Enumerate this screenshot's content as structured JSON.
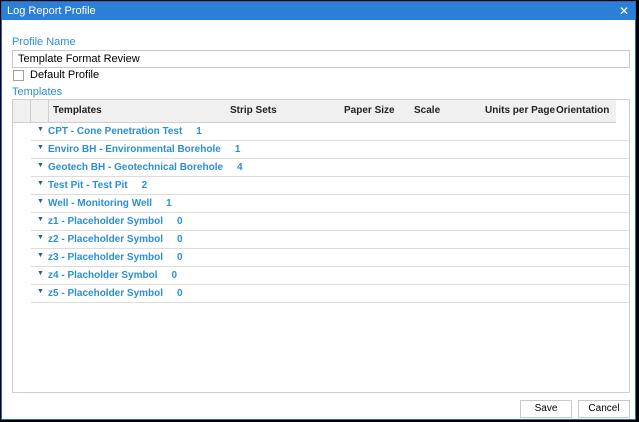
{
  "window": {
    "title": "Log Report Profile",
    "close_glyph": "✕"
  },
  "profile": {
    "label": "Profile Name",
    "value": "Template Format Review",
    "default_label": "Default Profile"
  },
  "templates": {
    "label": "Templates",
    "columns": [
      "Templates",
      "Strip Sets",
      "Paper Size",
      "Scale",
      "Units per Page",
      "Orientation"
    ],
    "rows": [
      {
        "name": "CPT - Cone Penetration Test",
        "count": "1"
      },
      {
        "name": "Enviro BH - Environmental Borehole",
        "count": "1"
      },
      {
        "name": "Geotech BH - Geotechnical Borehole",
        "count": "4"
      },
      {
        "name": "Test Pit - Test Pit",
        "count": "2"
      },
      {
        "name": "Well - Monitoring Well",
        "count": "1"
      },
      {
        "name": "z1 - Placeholder Symbol",
        "count": "0"
      },
      {
        "name": "z2 - Placeholder Symbol",
        "count": "0"
      },
      {
        "name": "z3 - Placeholder Symbol",
        "count": "0"
      },
      {
        "name": "z4 - Placholder Symbol",
        "count": "0"
      },
      {
        "name": "z5 - Placeholder Symbol",
        "count": "0"
      }
    ]
  },
  "buttons": {
    "save": "Save",
    "cancel": "Cancel"
  }
}
